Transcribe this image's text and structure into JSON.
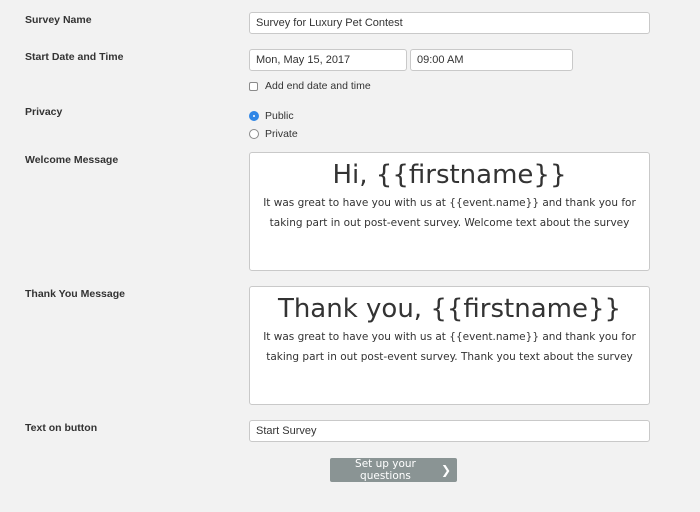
{
  "survey_name": {
    "label": "Survey Name",
    "value": "Survey for Luxury Pet Contest"
  },
  "start": {
    "label": "Start Date and Time",
    "date_value": "Mon, May 15, 2017",
    "time_value": "09:00 AM",
    "end_checkbox_label": "Add end date and time",
    "end_checkbox_checked": false
  },
  "privacy": {
    "label": "Privacy",
    "options": [
      {
        "label": "Public",
        "selected": true
      },
      {
        "label": "Private",
        "selected": false
      }
    ]
  },
  "welcome": {
    "label": "Welcome Message",
    "heading": "Hi, {{firstname}}",
    "body": "It was great to have you with us at {{event.name}} and thank you for taking part in out post-event survey. Welcome text about the survey"
  },
  "thank_you": {
    "label": "Thank You Message",
    "heading": "Thank you, {{firstname}}",
    "body": "It was great to have you with us at {{event.name}} and thank you for taking part in out post-event survey. Thank you text about the survey"
  },
  "button_text": {
    "label": "Text on button",
    "value": "Start Survey"
  },
  "submit": {
    "label": "Set up your questions",
    "icon": "chevron-right-icon"
  },
  "colors": {
    "accent": "#2f86e6",
    "submit_bg": "#8a9494",
    "background": "#f2f2f2"
  }
}
